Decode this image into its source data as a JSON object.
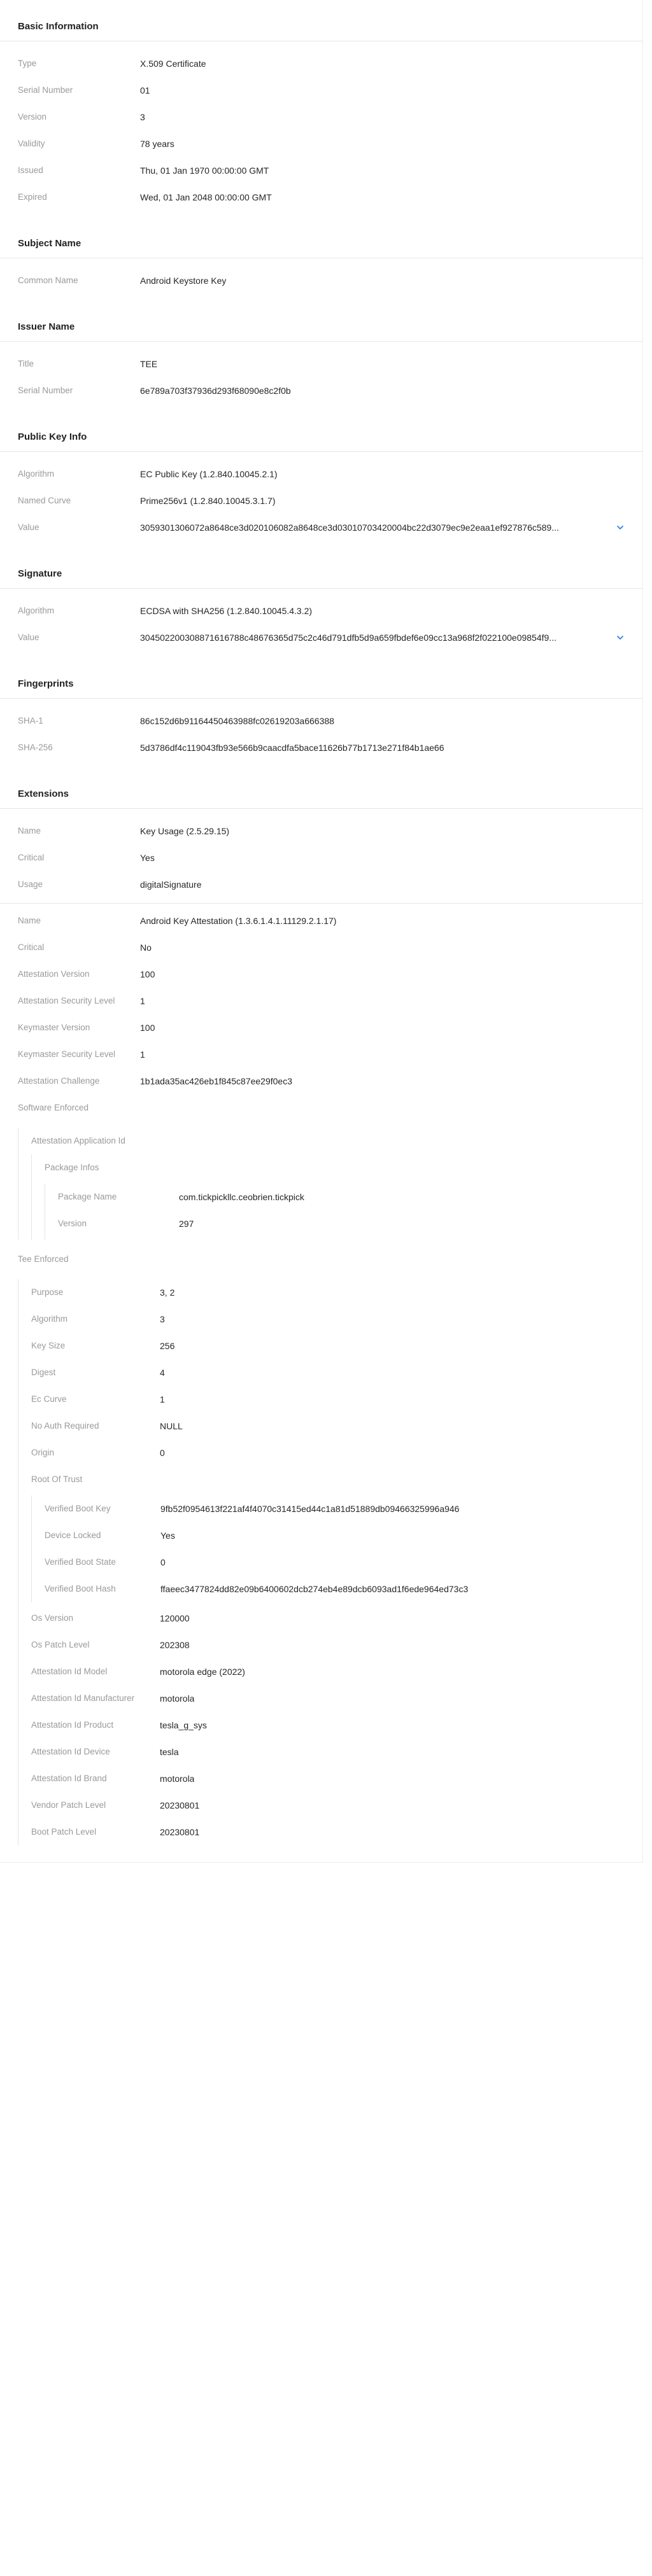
{
  "basic": {
    "title": "Basic Information",
    "type_label": "Type",
    "type": "X.509 Certificate",
    "serial_label": "Serial Number",
    "serial": "01",
    "version_label": "Version",
    "version": "3",
    "validity_label": "Validity",
    "validity": "78 years",
    "issued_label": "Issued",
    "issued": "Thu, 01 Jan 1970 00:00:00 GMT",
    "expired_label": "Expired",
    "expired": "Wed, 01 Jan 2048 00:00:00 GMT"
  },
  "subject": {
    "title": "Subject Name",
    "cn_label": "Common Name",
    "cn": "Android Keystore Key"
  },
  "issuer": {
    "title": "Issuer Name",
    "title_label": "Title",
    "title_value": "TEE",
    "serial_label": "Serial Number",
    "serial": "6e789a703f37936d293f68090e8c2f0b"
  },
  "pubkey": {
    "title": "Public Key Info",
    "algorithm_label": "Algorithm",
    "algorithm": "EC Public Key (1.2.840.10045.2.1)",
    "curve_label": "Named Curve",
    "curve": "Prime256v1 (1.2.840.10045.3.1.7)",
    "value_label": "Value",
    "value": "3059301306072a8648ce3d020106082a8648ce3d03010703420004bc22d3079ec9e2eaa1ef927876c589..."
  },
  "signature": {
    "title": "Signature",
    "algorithm_label": "Algorithm",
    "algorithm": "ECDSA with SHA256 (1.2.840.10045.4.3.2)",
    "value_label": "Value",
    "value": "304502200308871616788c48676365d75c2c46d791dfb5d9a659fbdef6e09cc13a968f2f022100e09854f9..."
  },
  "fingerprints": {
    "title": "Fingerprints",
    "sha1_label": "SHA-1",
    "sha1": "86c152d6b91164450463988fc02619203a666388",
    "sha256_label": "SHA-256",
    "sha256": "5d3786df4c119043fb93e566b9caacdfa5bace11626b77b1713e271f84b1ae66"
  },
  "extensions": {
    "title": "Extensions",
    "ku": {
      "name_label": "Name",
      "name": "Key Usage (2.5.29.15)",
      "critical_label": "Critical",
      "critical": "Yes",
      "usage_label": "Usage",
      "usage": "digitalSignature"
    },
    "att": {
      "name_label": "Name",
      "name": "Android Key Attestation (1.3.6.1.4.1.11129.2.1.17)",
      "critical_label": "Critical",
      "critical": "No",
      "att_version_label": "Attestation Version",
      "att_version": "100",
      "att_sec_label": "Attestation Security Level",
      "att_sec": "1",
      "km_version_label": "Keymaster Version",
      "km_version": "100",
      "km_sec_label": "Keymaster Security Level",
      "km_sec": "1",
      "challenge_label": "Attestation Challenge",
      "challenge": "1b1ada35ac426eb1f845c87ee29f0ec3",
      "sw_enforced_label": "Software Enforced",
      "app_id_label": "Attestation Application Id",
      "pkg_infos_label": "Package Infos",
      "pkg_name_label": "Package Name",
      "pkg_name": "com.tickpickllc.ceobrien.tickpick",
      "pkg_version_label": "Version",
      "pkg_version": "297",
      "tee_enforced_label": "Tee Enforced",
      "purpose_label": "Purpose",
      "purpose": "3, 2",
      "algorithm_label": "Algorithm",
      "algorithm": "3",
      "key_size_label": "Key Size",
      "key_size": "256",
      "digest_label": "Digest",
      "digest": "4",
      "ec_curve_label": "Ec Curve",
      "ec_curve": "1",
      "no_auth_label": "No Auth Required",
      "no_auth": "NULL",
      "origin_label": "Origin",
      "origin": "0",
      "rot_label": "Root Of Trust",
      "vbk_label": "Verified Boot Key",
      "vbk": "9fb52f0954613f221af4f4070c31415ed44c1a81d51889db09466325996a946",
      "locked_label": "Device Locked",
      "locked": "Yes",
      "vbs_label": "Verified Boot State",
      "vbs": "0",
      "vbh_label": "Verified Boot Hash",
      "vbh": "ffaeec3477824dd82e09b6400602dcb274eb4e89dcb6093ad1f6ede964ed73c3",
      "os_version_label": "Os Version",
      "os_version": "120000",
      "os_patch_label": "Os Patch Level",
      "os_patch": "202308",
      "model_label": "Attestation Id Model",
      "model": "motorola edge (2022)",
      "manufacturer_label": "Attestation Id Manufacturer",
      "manufacturer": "motorola",
      "product_label": "Attestation Id Product",
      "product": "tesla_g_sys",
      "device_label": "Attestation Id Device",
      "device": "tesla",
      "brand_label": "Attestation Id Brand",
      "brand": "motorola",
      "vendor_patch_label": "Vendor Patch Level",
      "vendor_patch": "20230801",
      "boot_patch_label": "Boot Patch Level",
      "boot_patch": "20230801"
    }
  },
  "icons": {
    "expand": "chevron-down-icon"
  },
  "colors": {
    "accent": "#2f80ed",
    "label": "#9a9a9a",
    "text": "#262626"
  }
}
